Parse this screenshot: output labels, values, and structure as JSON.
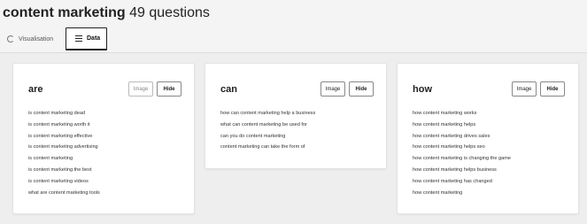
{
  "header": {
    "keyword": "content marketing",
    "count_label": " 49 questions"
  },
  "tabs": [
    {
      "label": "Visualisation",
      "icon": "circle-icon"
    },
    {
      "label": "Data",
      "icon": "list-icon"
    }
  ],
  "cards": [
    {
      "title": "are",
      "image_label": "Image",
      "hide_label": "Hide",
      "questions": [
        "is content marketing dead",
        "is content marketing worth it",
        "is content marketing effective",
        "is content marketing advertising",
        "is content marketing",
        "is content marketing the best",
        "is content marketing videos",
        "what are content marketing tools"
      ]
    },
    {
      "title": "can",
      "image_label": "Image",
      "hide_label": "Hide",
      "questions": [
        "how can content marketing help a business",
        "what can content marketing be used for",
        "can you do content marketing",
        "content marketing can take the form of"
      ]
    },
    {
      "title": "how",
      "image_label": "Image",
      "hide_label": "Hide",
      "questions": [
        "how content marketing works",
        "how content marketing helps",
        "how content marketing drives sales",
        "how content marketing helps seo",
        "how content marketing is changing the game",
        "how content marketing helps business",
        "how content marketing has changed",
        "how content marketing"
      ]
    }
  ]
}
